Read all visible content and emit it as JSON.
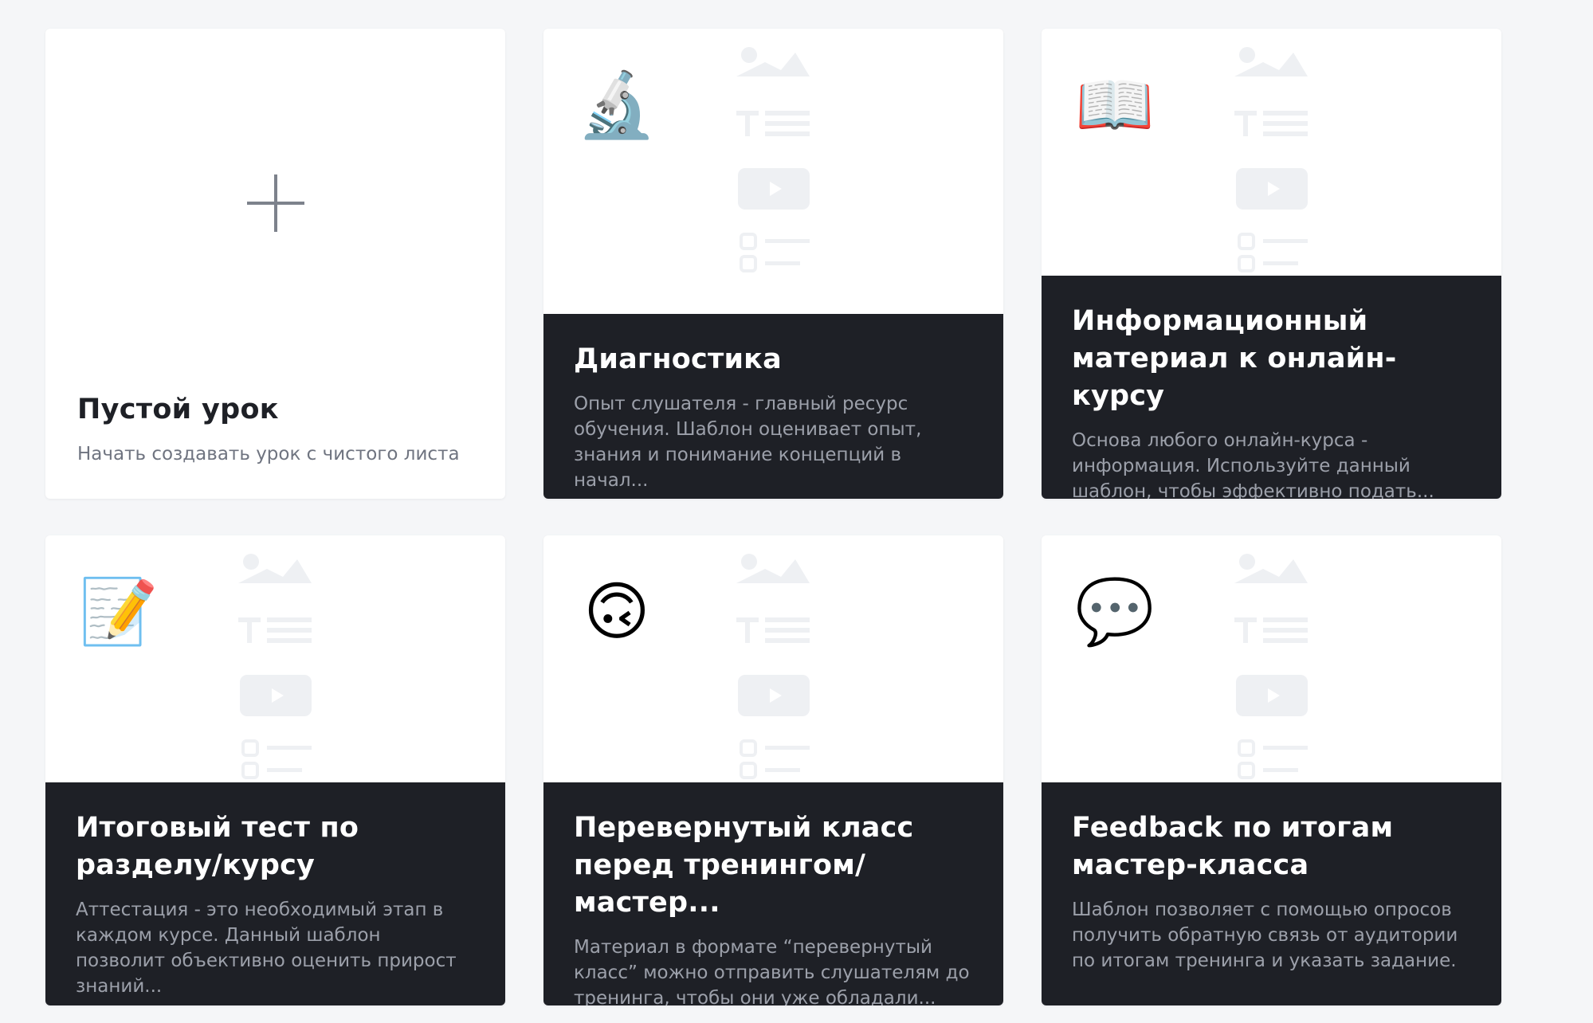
{
  "cards": [
    {
      "title": "Пустой урок",
      "description": "Начать создавать урок с чистого листа",
      "icon": "plus-icon"
    },
    {
      "title": "Диагностика",
      "description": "Опыт слушателя - главный ресурс обучения. Шаблон оценивает опыт, знания и понимание концепций в начал...",
      "icon": "🔬"
    },
    {
      "title": "Информационный материал к онлайн-курсу",
      "description": "Основа любого онлайн-курса - информация. Используйте данный шаблон, чтобы эффективно подать...",
      "icon": "📖"
    },
    {
      "title": "Итоговый тест по разделу/курсу",
      "description": "Аттестация - это необходимый этап в каждом курсе. Данный шаблон позволит объективно оценить прирост знаний...",
      "icon": "📝"
    },
    {
      "title": "Перевернутый класс перед тренингом/мастер...",
      "description": "Материал в формате “перевернутый класс” можно отправить слушателям до тренинга, чтобы они уже обладали...",
      "icon": "🙃"
    },
    {
      "title": "Feedback по итогам мастер-класса",
      "description": "Шаблон позволяет с помощью опросов получить обратную связь от аудитории по итогам тренинга и указать задание.",
      "icon": "💬"
    }
  ],
  "colors": {
    "dark": "#1e2026",
    "muted": "#9ca0aa",
    "skeleton": "#eef0f3",
    "background": "#f5f6f8"
  }
}
